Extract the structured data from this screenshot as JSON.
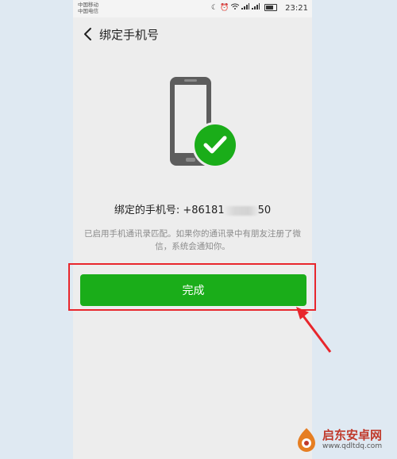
{
  "status_bar": {
    "carrier_1": "中国移动",
    "carrier_2": "中国电信",
    "icons": [
      "moon-icon",
      "alarm-icon",
      "wifi-icon",
      "signal-icon",
      "signal-icon",
      "battery-icon"
    ],
    "time": "23:21"
  },
  "nav": {
    "title": "绑定手机号"
  },
  "main": {
    "bound_prefix": "绑定的手机号: +86181",
    "bound_suffix": "50",
    "hint": "已启用手机通讯录匹配。如果你的通讯录中有朋友注册了微信，系统会通知你。",
    "done_label": "完成"
  },
  "colors": {
    "accent_green": "#1aad19",
    "annotation_red": "#e8262c"
  },
  "watermark": {
    "name": "启东安卓网",
    "url": "www.qdltdq.com"
  }
}
